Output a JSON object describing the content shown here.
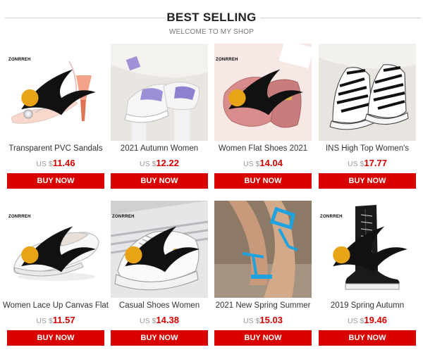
{
  "header": {
    "title": "BEST SELLING",
    "subtitle": "WELCOME TO MY SHOP"
  },
  "brand": {
    "logo_text": "ZONRREH"
  },
  "currency": "US $",
  "buy_label": "BUY NOW",
  "colors": {
    "accent": "#d90000",
    "price": "#d40000"
  },
  "products": [
    {
      "name": "Transparent PVC Sandals",
      "price": "11.46",
      "image": "clear-pvc-heel-sandal",
      "logo": true
    },
    {
      "name": "2021 Autumn Women",
      "price": "12.22",
      "image": "purple-sneakers",
      "logo": false
    },
    {
      "name": "Women Flat Shoes 2021",
      "price": "14.04",
      "image": "pink-quilted-flat",
      "logo": true
    },
    {
      "name": "INS High Top Women's",
      "price": "17.77",
      "image": "zebra-high-top",
      "logo": false
    },
    {
      "name": "Women Lace Up Canvas Flat",
      "price": "11.57",
      "image": "white-canvas-flat",
      "logo": true
    },
    {
      "name": "Casual Shoes Women",
      "price": "14.38",
      "image": "white-bee-sneaker",
      "logo": true
    },
    {
      "name": "2021 New Spring Summer",
      "price": "15.03",
      "image": "blue-strap-sandal",
      "logo": false
    },
    {
      "name": "2019 Spring Autumn",
      "price": "19.46",
      "image": "black-knee-boot",
      "logo": true
    }
  ]
}
